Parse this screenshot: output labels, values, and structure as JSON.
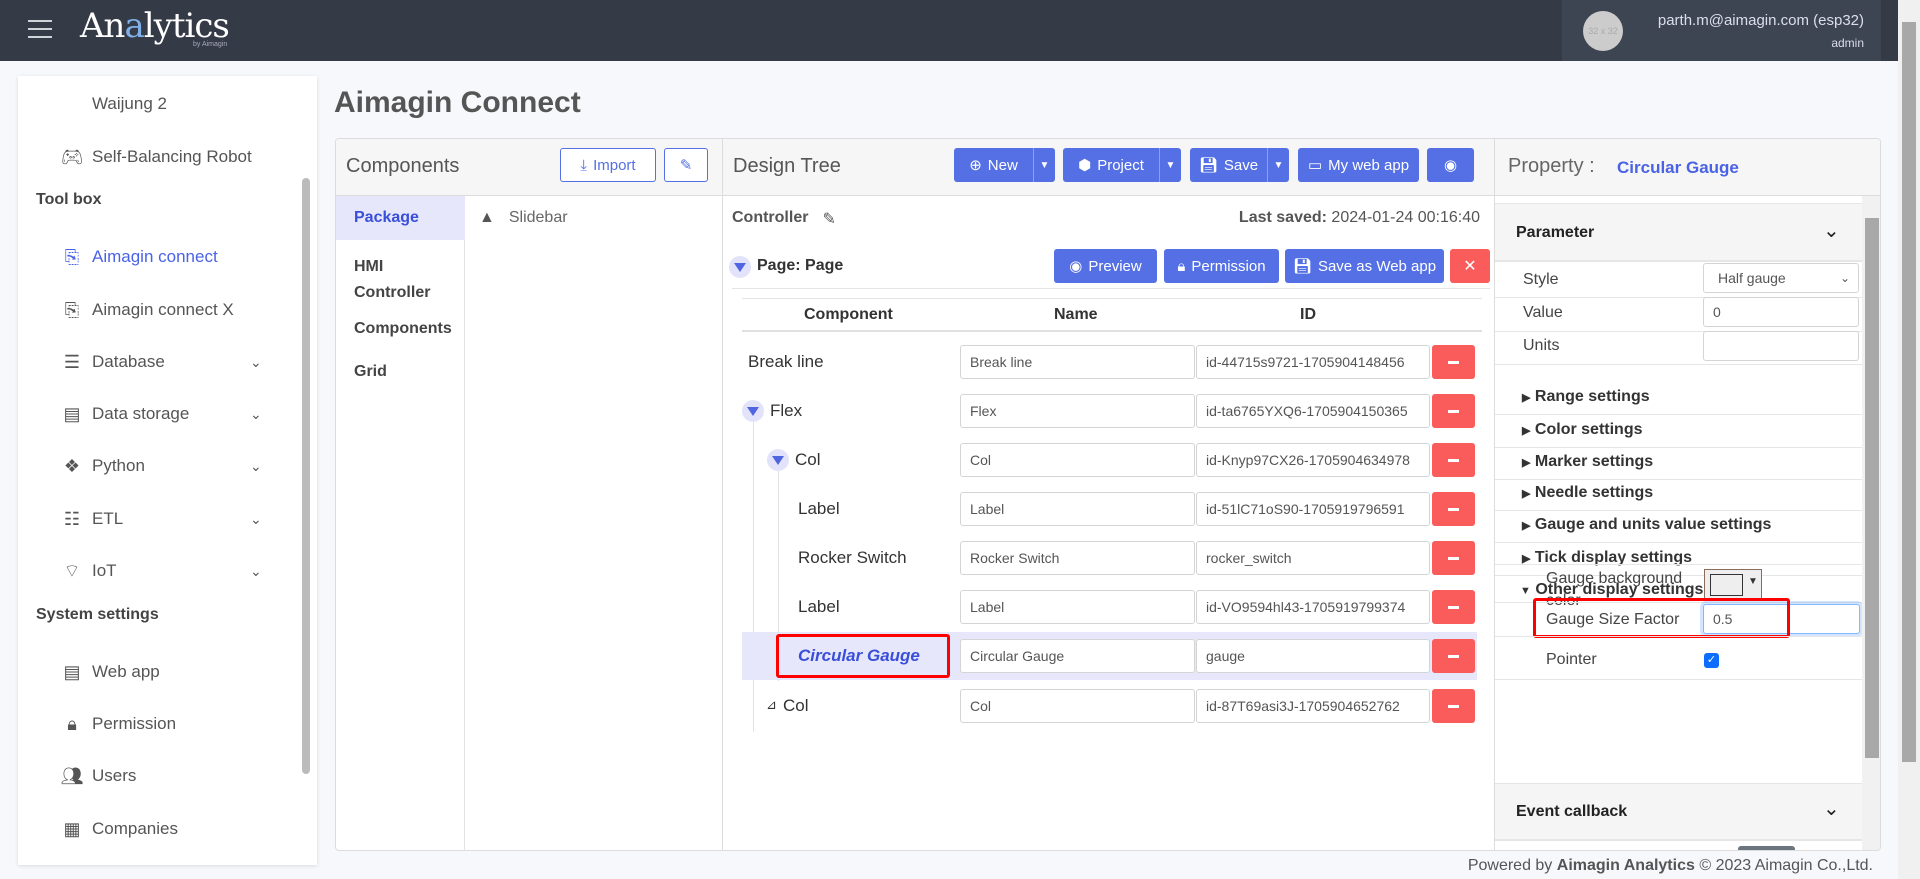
{
  "header": {
    "logo": "Analytics",
    "logo_sub": "by Aimagin",
    "user_email": "parth.m@aimagin.com (esp32)",
    "user_role": "admin",
    "avatar_placeholder": "32 x 32"
  },
  "sidebar": {
    "items_top": [
      {
        "label": "Waijung 2",
        "icon": ""
      },
      {
        "label": "Self-Balancing Robot",
        "icon": "gamepad-icon"
      }
    ],
    "toolbox_heading": "Tool box",
    "toolbox": [
      {
        "label": "Aimagin connect",
        "icon": "file-code-icon",
        "active": true
      },
      {
        "label": "Aimagin connect X",
        "icon": "file-code-icon"
      },
      {
        "label": "Database",
        "icon": "database-icon",
        "chevron": true
      },
      {
        "label": "Data storage",
        "icon": "server-icon",
        "chevron": true
      },
      {
        "label": "Python",
        "icon": "python-icon",
        "chevron": true
      },
      {
        "label": "ETL",
        "icon": "list-check-icon",
        "chevron": true
      },
      {
        "label": "IoT",
        "icon": "wifi-icon",
        "chevron": true
      }
    ],
    "system_heading": "System settings",
    "system": [
      {
        "label": "Web app",
        "icon": "server-icon"
      },
      {
        "label": "Permission",
        "icon": "lock-icon"
      },
      {
        "label": "Users",
        "icon": "users-icon"
      },
      {
        "label": "Companies",
        "icon": "building-icon"
      }
    ]
  },
  "page_title": "Aimagin Connect",
  "components": {
    "title": "Components",
    "import_label": "Import",
    "tabs": [
      "Package",
      "HMI Controller",
      "Components",
      "Grid"
    ],
    "active_tab": "Package",
    "items": [
      "Slidebar"
    ]
  },
  "design_tree": {
    "title": "Design Tree",
    "buttons": {
      "new": "New",
      "project": "Project",
      "save": "Save",
      "my_web_app": "My web app"
    },
    "controller": "Controller",
    "last_saved_label": "Last saved:",
    "last_saved_value": "2024-01-24 00:16:40",
    "page_label": "Page: Page",
    "page_buttons": {
      "preview": "Preview",
      "permission": "Permission",
      "save_as_web_app": "Save as Web app"
    },
    "columns": [
      "Component",
      "Name",
      "ID"
    ],
    "rows": [
      {
        "component": "Break line",
        "name": "Break line",
        "id": "id-44715s9721-1705904148456",
        "level": 0
      },
      {
        "component": "Flex",
        "name": "Flex",
        "id": "id-ta6765YXQ6-1705904150365",
        "level": 0,
        "expanded": true
      },
      {
        "component": "Col",
        "name": "Col",
        "id": "id-Knyp97CX26-1705904634978",
        "level": 1,
        "expanded": true
      },
      {
        "component": "Label",
        "name": "Label",
        "id": "id-51lC71oS90-1705919796591",
        "level": 2
      },
      {
        "component": "Rocker Switch",
        "name": "Rocker Switch",
        "id": "rocker_switch",
        "level": 2
      },
      {
        "component": "Label",
        "name": "Label",
        "id": "id-VO9594hl43-1705919799374",
        "level": 2
      },
      {
        "component": "Circular Gauge",
        "name": "Circular Gauge",
        "id": "gauge",
        "level": 2,
        "selected": true
      },
      {
        "component": "Col",
        "name": "Col",
        "id": "id-87T69asi3J-1705904652762",
        "level": 1,
        "collapsed_glyph": "⊿"
      }
    ]
  },
  "property": {
    "title": "Property :",
    "component": "Circular Gauge",
    "parameter_heading": "Parameter",
    "style_label": "Style",
    "style_value": "Half gauge",
    "value_label": "Value",
    "value_value": "0",
    "units_label": "Units",
    "units_value": "",
    "sections": [
      "Range settings",
      "Color settings",
      "Marker settings",
      "Needle settings",
      "Gauge and units value settings",
      "Tick display settings"
    ],
    "open_section": "Other display settings",
    "bg_color_label": "Gauge background color",
    "bg_color_value": "#ffffff",
    "size_factor_label": "Gauge Size Factor",
    "size_factor_value": "0.5",
    "pointer_label": "Pointer",
    "pointer_checked": true,
    "event_heading": "Event callback"
  },
  "footer": {
    "prefix": "Powered by",
    "brand": "Aimagin Analytics",
    "suffix": "© 2023 Aimagin Co.,Ltd."
  },
  "colors": {
    "accent": "#5470e4",
    "danger": "#fa5b5b",
    "topbar": "#343a46",
    "highlight": "#e2e3fb",
    "annotation": "#ff0000"
  }
}
